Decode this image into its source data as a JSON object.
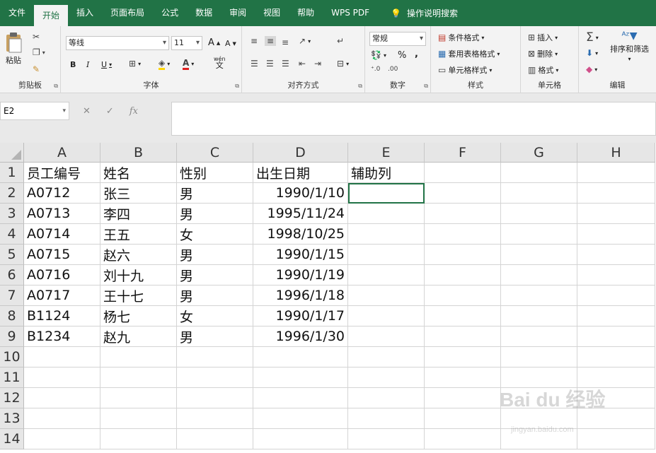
{
  "tabs": [
    "文件",
    "开始",
    "插入",
    "页面布局",
    "公式",
    "数据",
    "审阅",
    "视图",
    "帮助",
    "WPS PDF"
  ],
  "active_tab": "开始",
  "tell_me": "操作说明搜索",
  "ribbon": {
    "clipboard": {
      "paste": "粘贴",
      "label": "剪贴板"
    },
    "font": {
      "name": "等线",
      "size": "11",
      "label": "字体",
      "bold": "B",
      "italic": "I",
      "underline": "U",
      "grow": "A",
      "shrink": "A",
      "wen": "wén",
      "wen_char": "文"
    },
    "align": {
      "label": "对齐方式"
    },
    "number": {
      "format": "常规",
      "label": "数字",
      "percent": "%",
      "comma": ","
    },
    "styles": {
      "cond": "条件格式",
      "table": "套用表格格式",
      "cell": "单元格样式",
      "label": "样式"
    },
    "cells": {
      "insert": "插入",
      "delete": "删除",
      "format": "格式",
      "label": "单元格"
    },
    "edit": {
      "sort": "排序和筛选",
      "label": "编辑"
    }
  },
  "formula_bar": {
    "name_box": "E2",
    "content": ""
  },
  "columns": [
    "A",
    "B",
    "C",
    "D",
    "E",
    "F",
    "G",
    "H"
  ],
  "rows": [
    [
      "员工编号",
      "姓名",
      "性别",
      "出生日期",
      "辅助列"
    ],
    [
      "A0712",
      "张三",
      "男",
      "1990/1/10",
      ""
    ],
    [
      "A0713",
      "李四",
      "男",
      "1995/11/24",
      ""
    ],
    [
      "A0714",
      "王五",
      "女",
      "1998/10/25",
      ""
    ],
    [
      "A0715",
      "赵六",
      "男",
      "1990/1/15",
      ""
    ],
    [
      "A0716",
      "刘十九",
      "男",
      "1990/1/19",
      ""
    ],
    [
      "A0717",
      "王十七",
      "男",
      "1996/1/18",
      ""
    ],
    [
      "B1124",
      "杨七",
      "女",
      "1990/1/17",
      ""
    ],
    [
      "B1234",
      "赵九",
      "男",
      "1996/1/30",
      ""
    ]
  ],
  "row_numbers": [
    "1",
    "2",
    "3",
    "4",
    "5",
    "6",
    "7",
    "8",
    "9",
    "10",
    "11",
    "12",
    "13",
    "14"
  ],
  "watermark": {
    "brand": "Bai du 经验",
    "url": "jingyan.baidu.com"
  },
  "colors": {
    "accent": "#217346"
  }
}
